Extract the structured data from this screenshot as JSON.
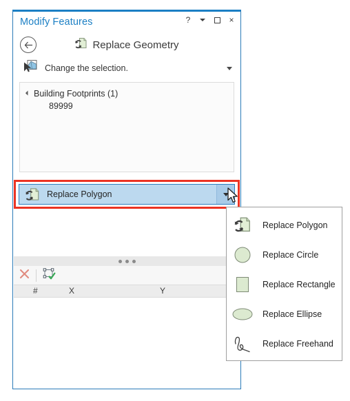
{
  "window": {
    "title": "Modify Features",
    "buttons": {
      "help": "?",
      "menu_caret": "menu-caret",
      "maximize": "maximize",
      "close": "×"
    }
  },
  "command": {
    "back": "←",
    "title": "Replace Geometry",
    "icon": "replace-geometry-icon"
  },
  "selection_row": {
    "label": "Change the selection.",
    "icon": "select-features-icon",
    "caret": "chevron-down-icon"
  },
  "tree": {
    "layer": "Building Footprints (1)",
    "features": [
      "89999"
    ]
  },
  "combobox": {
    "value": "Replace Polygon",
    "icon": "replace-polygon-icon",
    "caret": "chevron-down-icon"
  },
  "menu": {
    "items": [
      {
        "label": "Replace Polygon",
        "icon": "replace-polygon-icon"
      },
      {
        "label": "Replace Circle",
        "icon": "replace-circle-icon"
      },
      {
        "label": "Replace Rectangle",
        "icon": "replace-rectangle-icon"
      },
      {
        "label": "Replace Ellipse",
        "icon": "replace-ellipse-icon"
      },
      {
        "label": "Replace Freehand",
        "icon": "replace-freehand-icon"
      }
    ]
  },
  "grid": {
    "toolbar": {
      "delete": "delete-vertices-icon",
      "finish": "finish-geometry-icon"
    },
    "columns": [
      "#",
      "X",
      "Y"
    ],
    "rows": []
  },
  "colors": {
    "accent": "#1b7fc4",
    "highlight": "#bcd9ef",
    "annotation": "#ec3323",
    "icon_fill": "#dcead0"
  }
}
